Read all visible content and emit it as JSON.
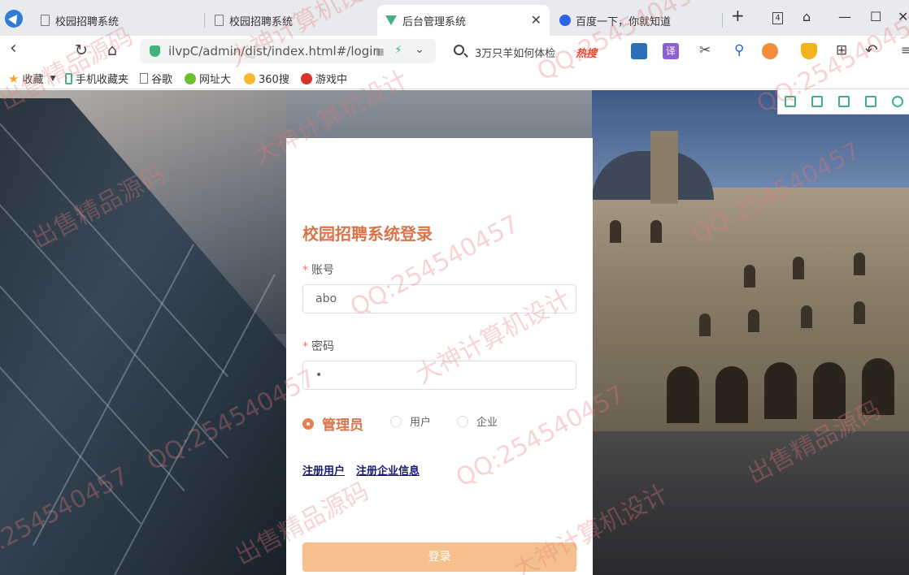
{
  "browser": {
    "tabs": [
      {
        "label": "校园招聘系统",
        "active": false
      },
      {
        "label": "校园招聘系统",
        "active": false
      },
      {
        "label": "后台管理系统",
        "active": true
      },
      {
        "label": "百度一下，你就知道",
        "active": false
      }
    ],
    "tab_count": "4",
    "url": "ilvpC/admin/dist/index.html#/login",
    "search_text": "3万只羊如何体检",
    "hot_label": "热搜",
    "translate_label": "译",
    "bookmarks": [
      {
        "label": "收藏",
        "icon": "star-icon"
      },
      {
        "label": "手机收藏夹",
        "icon": "phone-icon"
      },
      {
        "label": "谷歌",
        "icon": "page-icon"
      },
      {
        "label": "网址大",
        "icon": "site-icon"
      },
      {
        "label": "360搜",
        "icon": "search-360-icon"
      },
      {
        "label": "游戏中",
        "icon": "game-icon"
      }
    ]
  },
  "login": {
    "title": "校园招聘系统登录",
    "account_label": "账号",
    "account_value": "abo",
    "password_label": "密码",
    "password_value": "•",
    "required_mark": "*",
    "roles": [
      {
        "label": "管理员",
        "selected": true
      },
      {
        "label": "用户",
        "selected": false
      },
      {
        "label": "企业",
        "selected": false
      }
    ],
    "register_user": "注册用户",
    "register_company": "注册企业信息",
    "login_button": "登录"
  },
  "watermark": {
    "qq": "QQ:254540457",
    "text_a": "大神计算机设计",
    "text_b": "出售精品源码"
  },
  "colors": {
    "accent": "#d9734a",
    "button": "#f6c08c",
    "link": "#1a1a6e",
    "browser_green": "#3fb27f"
  }
}
